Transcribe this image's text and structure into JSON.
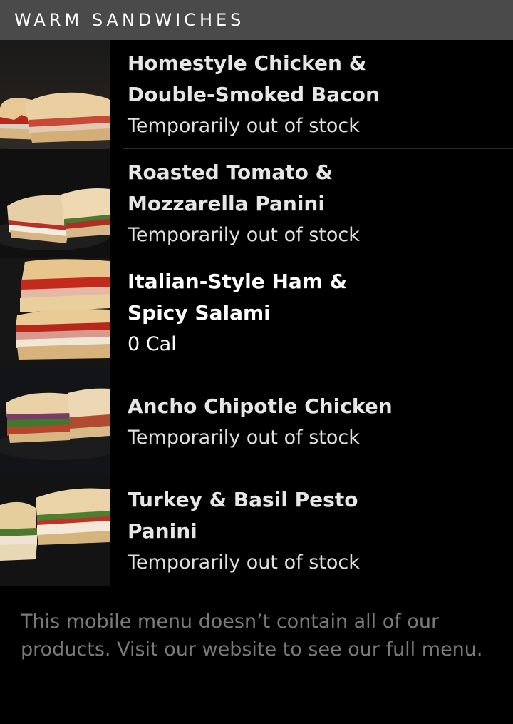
{
  "section": {
    "title": "WARM SANDWICHES"
  },
  "items": [
    {
      "name": "Homestyle Chicken & Double-Smoked Bacon",
      "status": "Temporarily out of stock",
      "image": "sandwich-photo"
    },
    {
      "name": "Roasted Tomato & Mozzarella Panini",
      "status": "Temporarily out of stock",
      "image": "sandwich-photo"
    },
    {
      "name": "Italian-Style Ham & Spicy Salami",
      "status": "0 Cal",
      "image": "sandwich-photo"
    },
    {
      "name": "Ancho Chipotle Chicken",
      "status": "Temporarily out of stock",
      "image": "sandwich-photo"
    },
    {
      "name": "Turkey & Basil Pesto Panini",
      "status": "Temporarily out of stock",
      "image": "sandwich-photo"
    }
  ],
  "footer": {
    "note": "This mobile menu doesn’t contain all of our products. Visit our website to see our full menu."
  },
  "colors": {
    "header_bg": "#4a4a4a",
    "page_bg": "#000000",
    "text_primary": "#e6e6e6",
    "text_muted": "#7a7a7a"
  }
}
